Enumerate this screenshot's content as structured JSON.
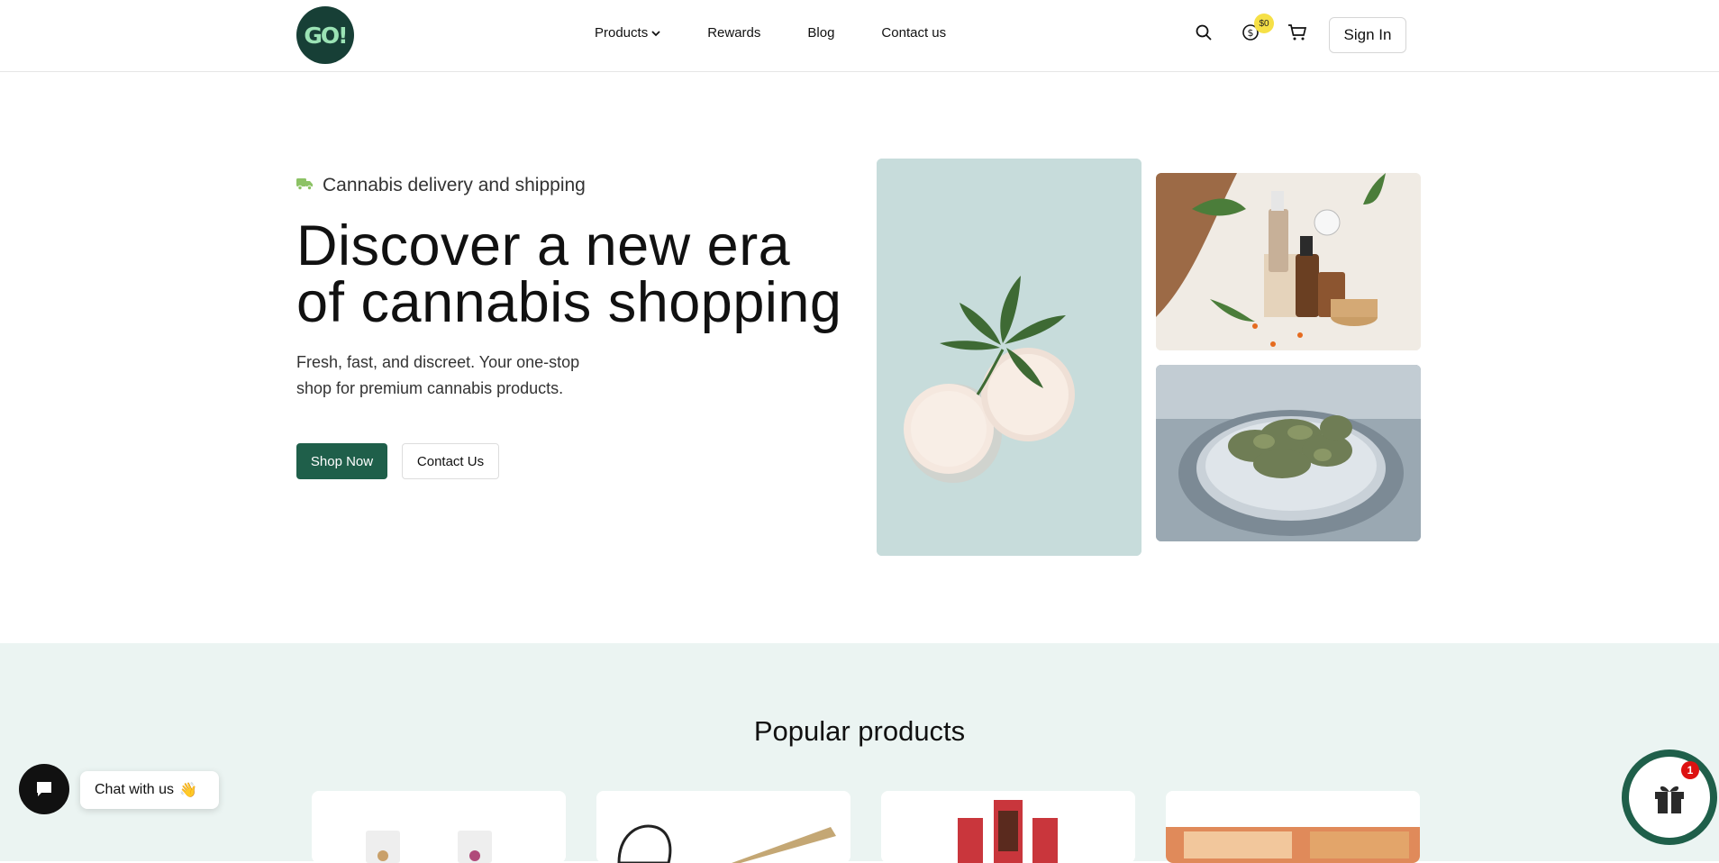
{
  "header": {
    "logo_text": "GO!",
    "nav": [
      {
        "label": "Products"
      },
      {
        "label": "Rewards"
      },
      {
        "label": "Blog"
      },
      {
        "label": "Contact us"
      }
    ],
    "balance": "$0",
    "signin_label": "Sign In"
  },
  "hero": {
    "tagline": "Cannabis delivery and shipping",
    "headline_line1": "Discover a new era",
    "headline_line2": "of cannabis shopping",
    "sub_line1": "Fresh, fast, and discreet. Your one-stop",
    "sub_line2": "shop for premium cannabis products.",
    "shop_now_label": "Shop Now",
    "contact_label": "Contact Us"
  },
  "popular": {
    "title": "Popular products"
  },
  "chat": {
    "label": "Chat with us",
    "emoji": "👋"
  },
  "gift": {
    "count": "1"
  },
  "colors": {
    "brand_green": "#1f5f4a",
    "logo_bg": "#173f36",
    "section_bg": "#ebf4f2",
    "badge_yellow": "#f6e046",
    "alert_red": "#dd1111"
  }
}
